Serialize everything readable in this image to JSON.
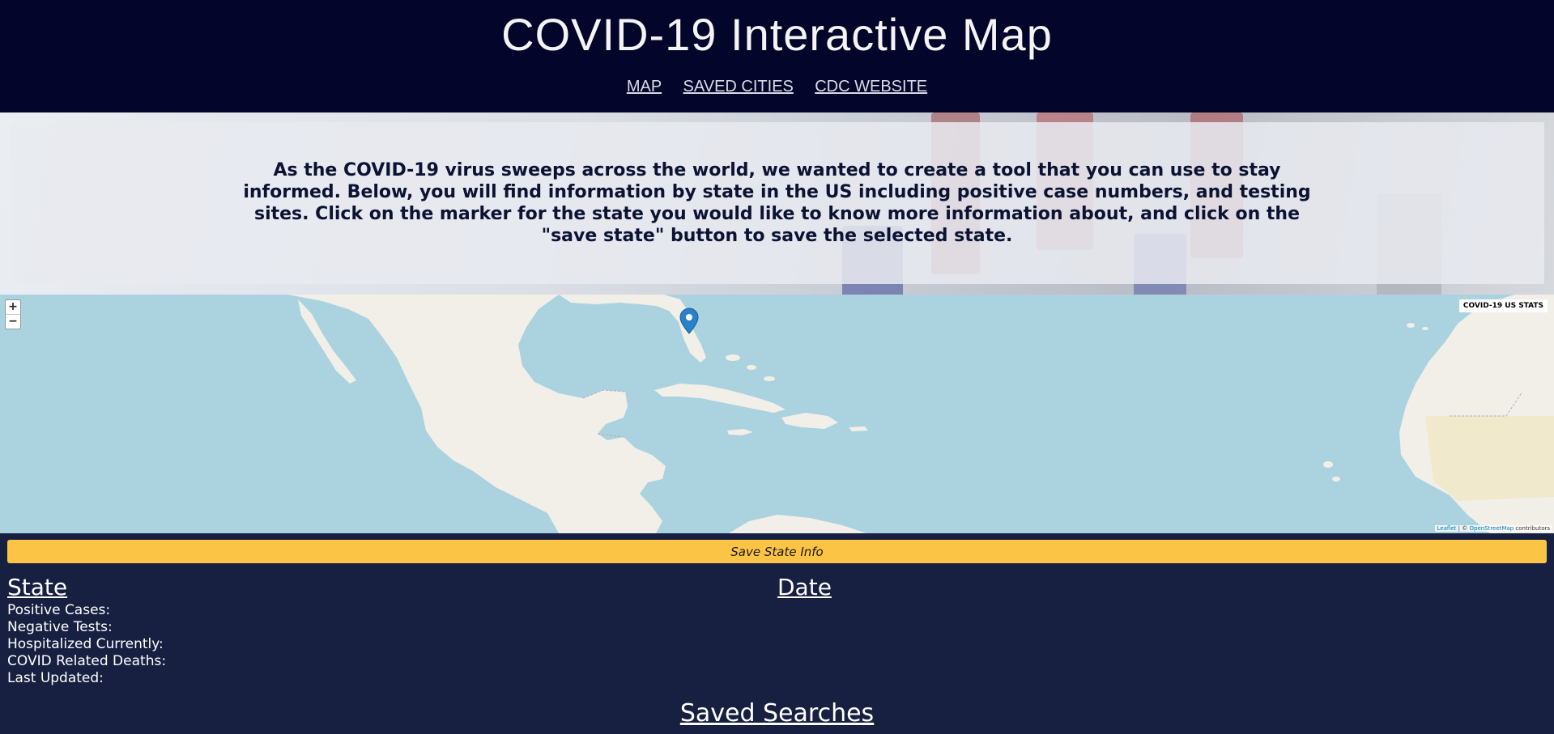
{
  "header": {
    "title": "COVID-19 Interactive Map",
    "nav": [
      "MAP",
      "SAVED CITIES",
      "CDC WEBSITE"
    ]
  },
  "intro": {
    "text": "As the COVID-19 virus sweeps across the world, we wanted to create a tool that you can use to stay informed. Below, you will find information by state in the US including positive case numbers, and testing sites. Click on the marker for the state you would like to know more information about, and click on the \"save state\" button to save the selected state."
  },
  "map": {
    "zoom_in": "+",
    "zoom_out": "−",
    "title_box": "COVID-19 US STATS",
    "attribution_leaflet": "Leaflet",
    "attribution_sep": " | © ",
    "attribution_osm": "OpenStreetMap",
    "attribution_tail": " contributors",
    "marker_icon": "map-pin",
    "water_color": "#aad3df",
    "land_color": "#f2efe9"
  },
  "actions": {
    "save_label": "Save State Info"
  },
  "stats": {
    "state_heading": "State",
    "date_heading": "Date",
    "labels": [
      "Positive Cases:",
      "Negative Tests:",
      "Hospitalized Currently:",
      "COVID Related Deaths:",
      "Last Updated:"
    ]
  },
  "saved": {
    "heading": "Saved Searches"
  },
  "colors": {
    "header_bg": "#03052a",
    "page_bg": "#172040",
    "accent": "#fcc444"
  }
}
